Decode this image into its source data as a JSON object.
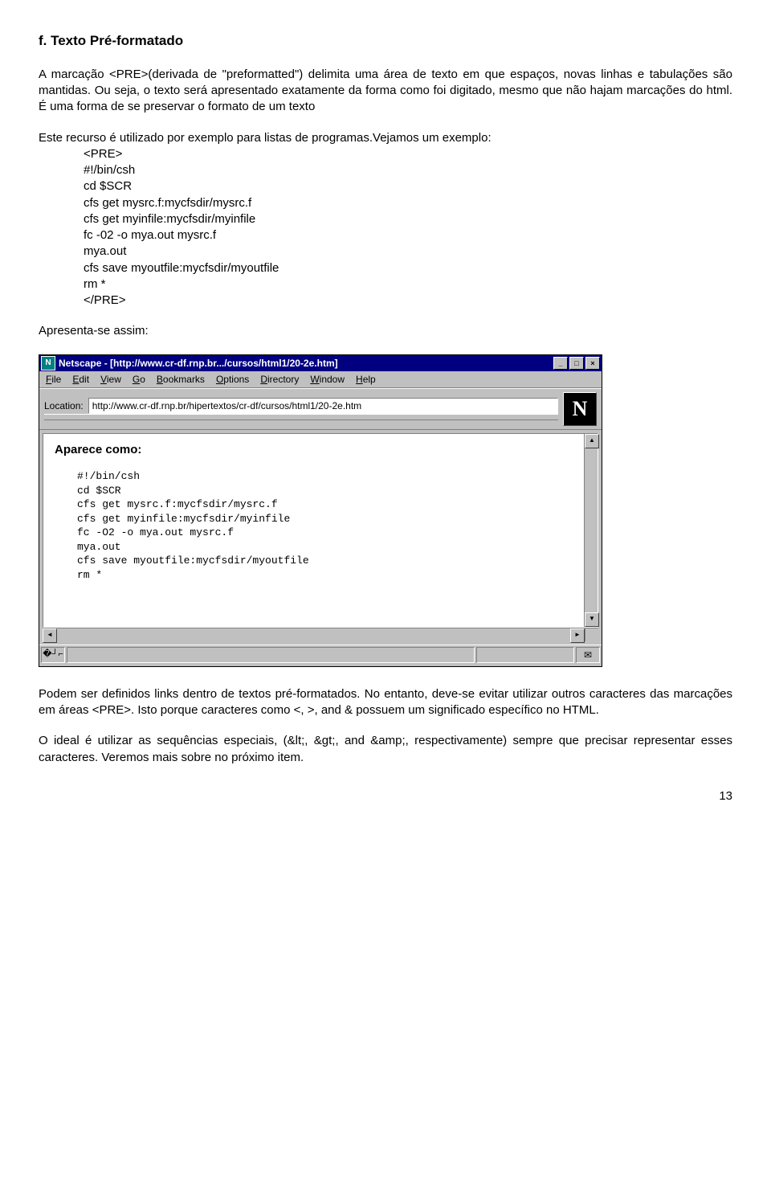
{
  "section_title": "f. Texto Pré-formatado",
  "para1": "A marcação <PRE>(derivada de \"preformatted\") delimita uma área de texto em que espaços, novas linhas e tabulações são mantidas. Ou seja, o texto será apresentado exatamente da forma como foi digitado, mesmo que não hajam marcações do html. É uma forma de se preservar o formato de um texto",
  "para2": "Este recurso é utilizado por exemplo para listas de programas.Vejamos um exemplo:",
  "example_lines": [
    "<PRE>",
    "#!/bin/csh",
    "cd $SCR",
    "cfs get mysrc.f:mycfsdir/mysrc.f",
    "cfs get myinfile:mycfsdir/myinfile",
    "fc -02 -o mya.out mysrc.f",
    "mya.out",
    "cfs save myoutfile:mycfsdir/myoutfile",
    "rm *",
    "</PRE>"
  ],
  "para3": "Apresenta-se assim:",
  "netscape": {
    "title": "Netscape - [http://www.cr-df.rnp.br.../cursos/html1/20-2e.htm]",
    "icon_letter": "N",
    "menus": [
      "File",
      "Edit",
      "View",
      "Go",
      "Bookmarks",
      "Options",
      "Directory",
      "Window",
      "Help"
    ],
    "location_label": "Location:",
    "location_value": "http://www.cr-df.rnp.br/hipertextos/cr-df/cursos/html1/20-2e.htm",
    "logo_letter": "N",
    "viewport_heading": "Aparece como:",
    "viewport_code": "#!/bin/csh\ncd $SCR\ncfs get mysrc.f:mycfsdir/mysrc.f\ncfs get myinfile:mycfsdir/myinfile\nfc -O2 -o mya.out mysrc.f\nmya.out\ncfs save myoutfile:mycfsdir/myoutfile\nrm *",
    "winbtns": {
      "min": "_",
      "max": "□",
      "close": "×"
    },
    "scroll": {
      "up": "▲",
      "down": "▼",
      "left": "◄",
      "right": "►"
    },
    "status_icon": "�┘⌐",
    "mail_icon": "✉"
  },
  "para4": "Podem ser definidos links dentro de textos pré-formatados. No entanto, deve-se evitar utilizar outros caracteres das marcações em áreas <PRE>. Isto porque caracteres como <, >, and & possuem um significado específico no HTML.",
  "para5": "O ideal é utilizar as sequências especiais, (&lt;, &gt;, and &amp;, respectivamente) sempre que precisar representar esses caracteres. Veremos mais sobre no próximo item.",
  "page_number": "13"
}
